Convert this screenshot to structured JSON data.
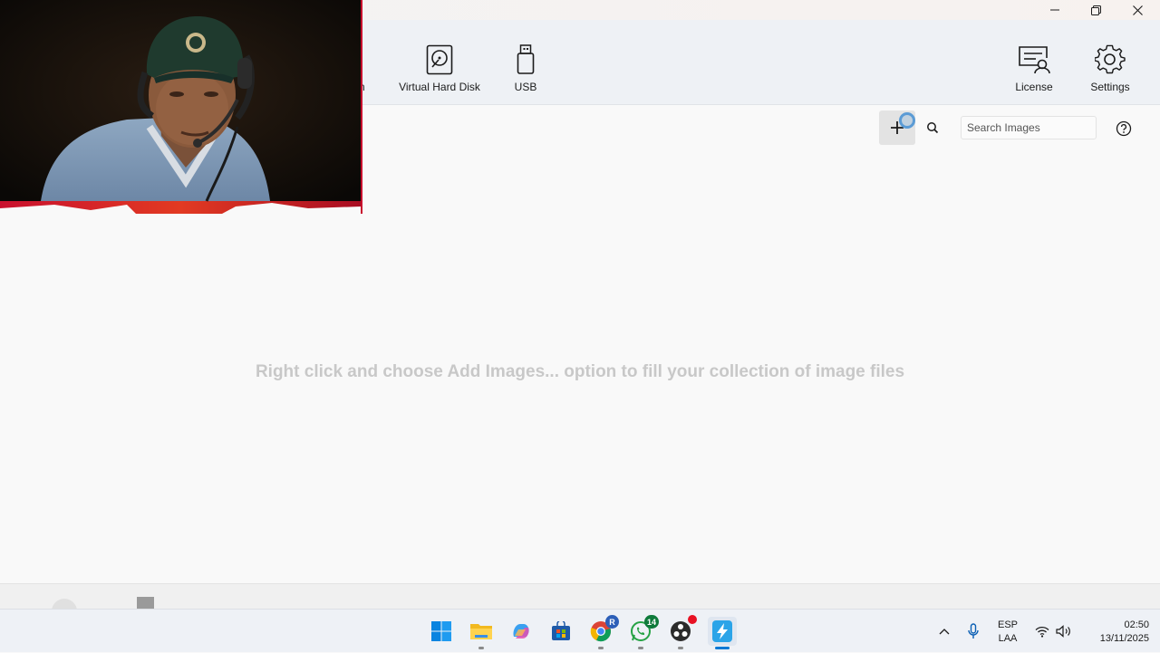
{
  "ribbon": {
    "partial_label": "n",
    "virtual_hard_disk": "Virtual Hard Disk",
    "usb": "USB",
    "license": "License",
    "settings": "Settings"
  },
  "toolbar": {
    "search_placeholder": "Search Images"
  },
  "main": {
    "empty_message": "Right click and choose Add Images... option to fill your collection of image files"
  },
  "taskbar": {
    "chrome_badge": "R",
    "whatsapp_badge": "14",
    "language_line1": "ESP",
    "language_line2": "LAA",
    "time": "02:50",
    "date": "13/11/2025"
  },
  "colors": {
    "accent_blue": "#0078d4",
    "empty_message_gray": "#c8c8c8",
    "ribbon_bg": "#eef1f5",
    "webcam_frame_red": "#c8102e"
  }
}
